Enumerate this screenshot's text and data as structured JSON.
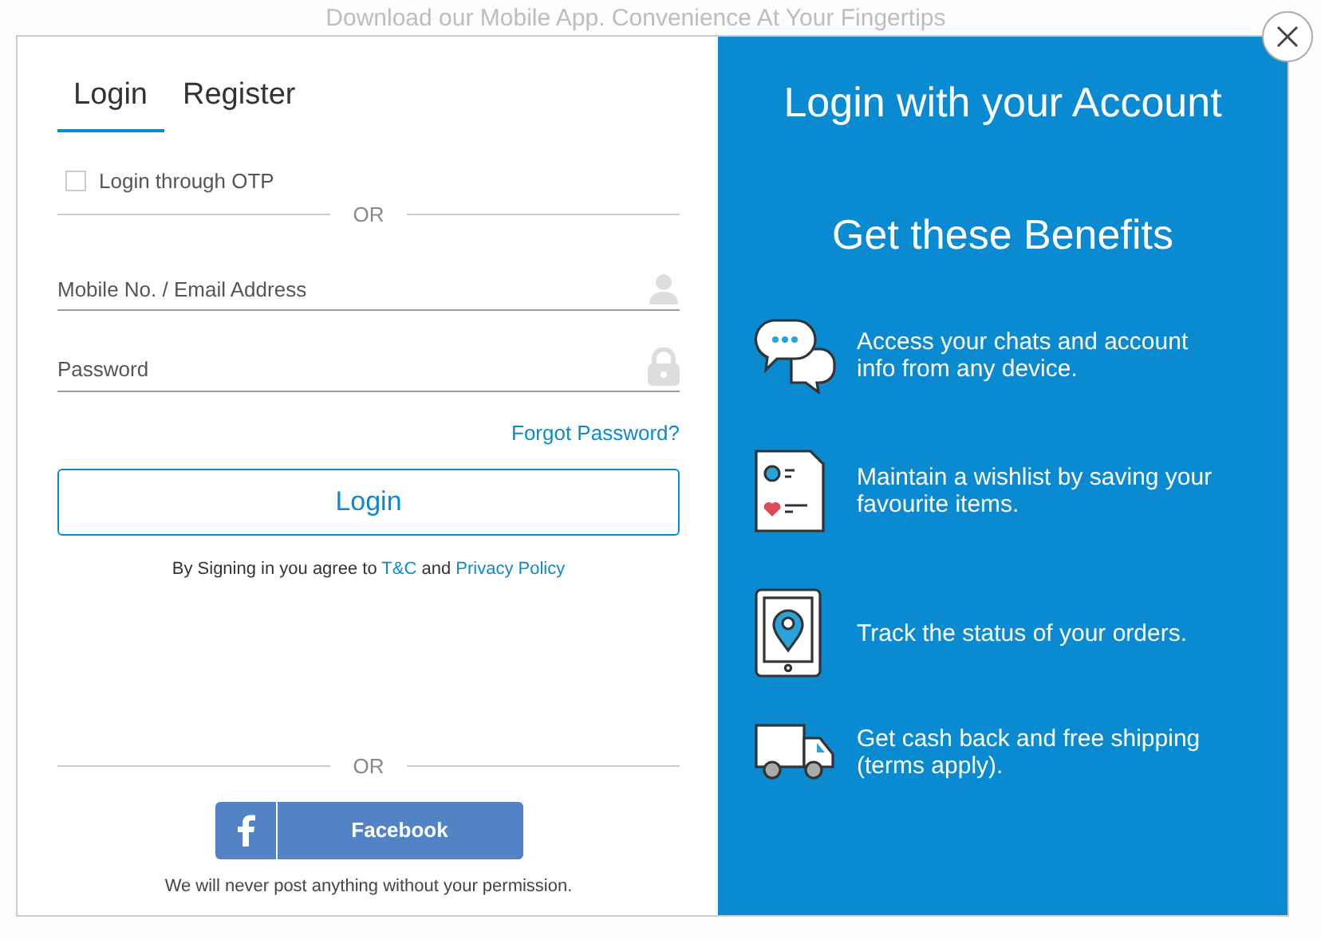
{
  "banner": {
    "text": "Download our Mobile App. Convenience At Your Fingertips"
  },
  "tabs": [
    {
      "label": "Login",
      "selected": true
    },
    {
      "label": "Register",
      "selected": false
    }
  ],
  "otp": {
    "label": "Login through OTP",
    "checked": false
  },
  "divider_top": "OR",
  "fields": [
    {
      "kind": "user",
      "placeholder": "Mobile No. / Email Address"
    },
    {
      "kind": "password",
      "placeholder": "Password"
    }
  ],
  "forgot_link": "Forgot Password?",
  "login_button": "Login",
  "terms": {
    "before": "By Signing in you agree to",
    "tc_link": "T&C",
    "middle": "and",
    "privacy_link": "Privacy Policy"
  },
  "divider_bottom": "OR",
  "facebook_button": "Facebook",
  "notice": "We will never post anything without your permission.",
  "benefits": {
    "title": "Login with your Account",
    "subtitle": "Get these Benefits",
    "items": [
      {
        "kind": "chat",
        "text": "Access your chats and account info from any device."
      },
      {
        "kind": "wishlist",
        "text": "Maintain a wishlist by saving your favourite items."
      },
      {
        "kind": "track",
        "text": "Track the status of your orders."
      },
      {
        "kind": "shipping",
        "text": "Get cash back and free shipping (terms apply)."
      }
    ]
  }
}
